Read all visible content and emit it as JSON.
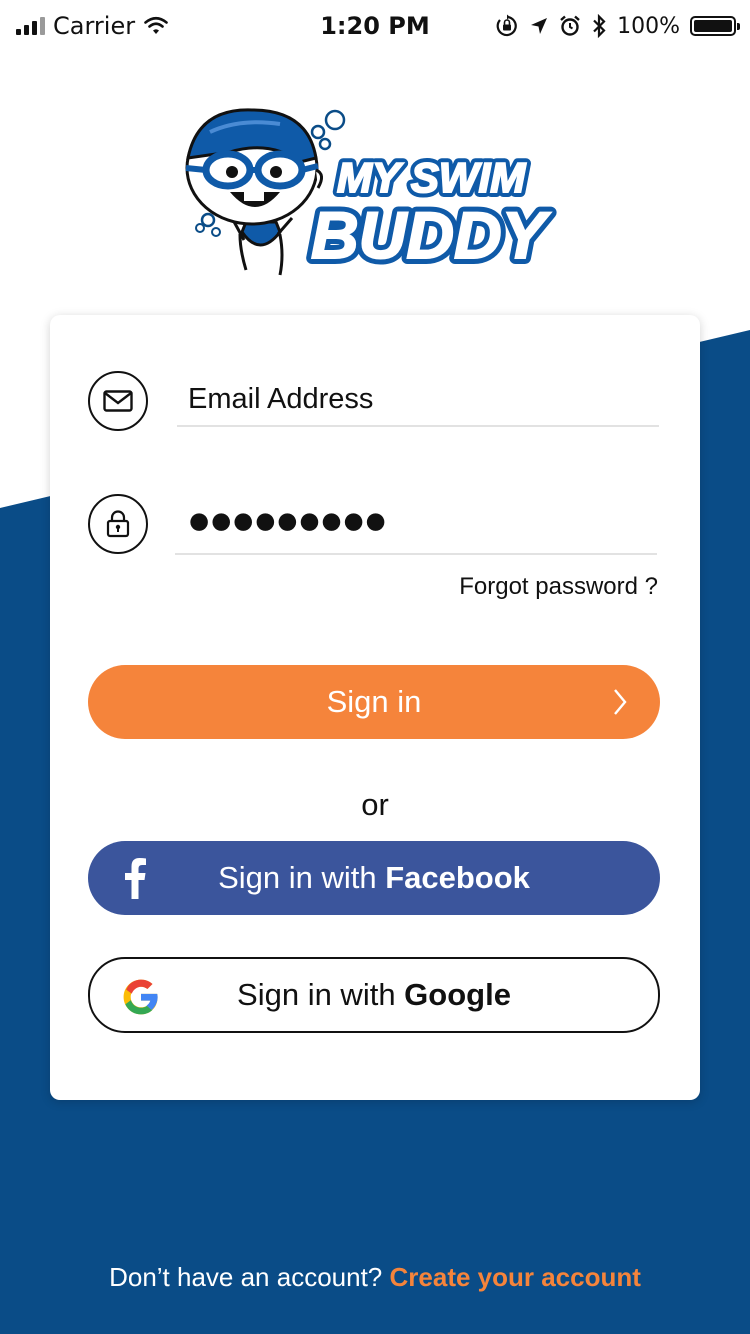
{
  "colors": {
    "navy": "#0a4c87",
    "accent_orange": "#f5843b",
    "facebook_blue": "#3b559c",
    "text_dark": "#111111"
  },
  "status_bar": {
    "carrier": "Carrier",
    "time": "1:20 PM",
    "battery": "100%",
    "icons": [
      "signal-icon",
      "wifi-icon",
      "rotation-lock-icon",
      "location-icon",
      "alarm-icon",
      "bluetooth-icon",
      "battery-icon"
    ]
  },
  "logo": {
    "line1": "MY SWIM",
    "line2": "BUDDY"
  },
  "login_form": {
    "email_placeholder": "Email Address",
    "password_mask": "●●●●●●●●●",
    "forgot_password": "Forgot password ?",
    "sign_in_label": "Sign in",
    "or_label": "or",
    "facebook_prefix": "Sign in with ",
    "facebook_brand": "Facebook",
    "google_prefix": "Sign in with ",
    "google_brand": "Google"
  },
  "footer": {
    "prompt": "Don’t have an account? ",
    "link": "Create your account"
  }
}
